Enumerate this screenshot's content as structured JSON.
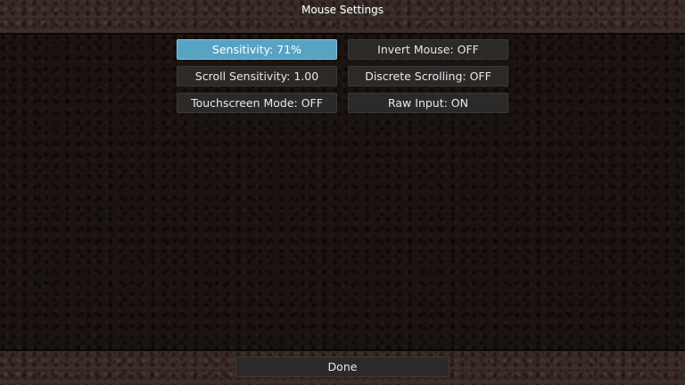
{
  "screen": {
    "title": "Mouse Settings"
  },
  "options": {
    "sensitivity": "Sensitivity: 71%",
    "invert_mouse": "Invert Mouse: OFF",
    "scroll_sensitivity": "Scroll Sensitivity: 1.00",
    "discrete_scrolling": "Discrete Scrolling: OFF",
    "touchscreen_mode": "Touchscreen Mode: OFF",
    "raw_input": "Raw Input: ON"
  },
  "footer": {
    "done_label": "Done"
  },
  "colors": {
    "focused_button": "#57a3c4",
    "button": "#2c2a28",
    "list_background": "#1a130f",
    "dirt_band": "#3d2e28"
  }
}
